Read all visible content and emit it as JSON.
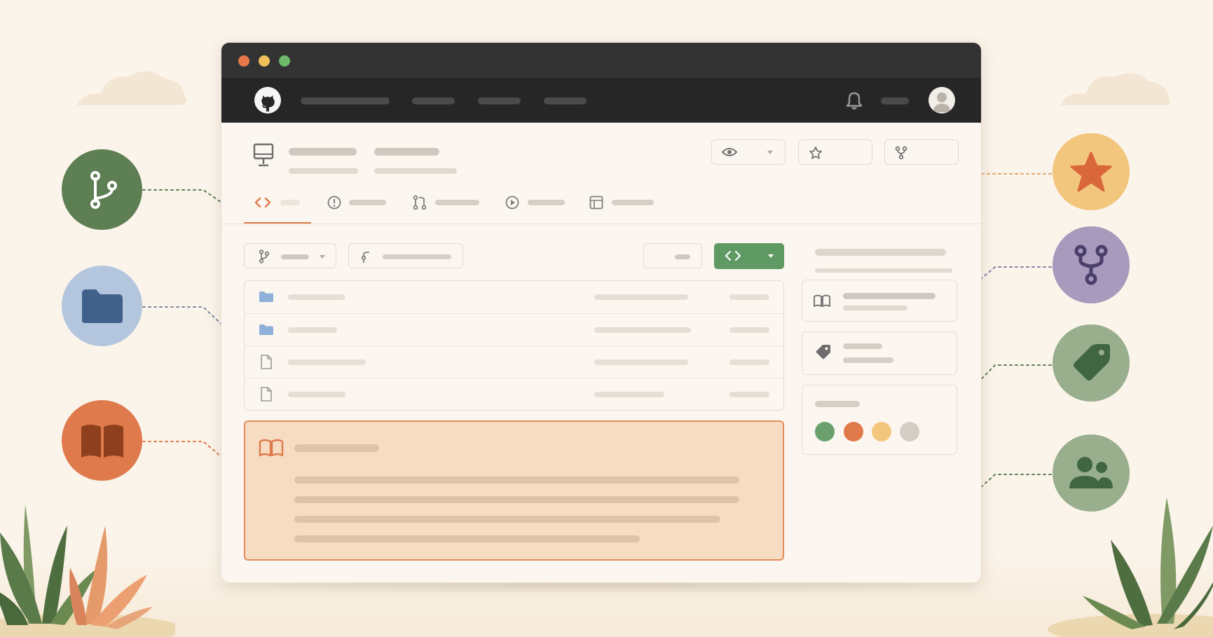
{
  "colors": {
    "background": "#fbf4ea",
    "titlebar": "#333333",
    "navbar": "#262626",
    "accent_orange": "#e07a4a",
    "accent_green": "#5f9a64",
    "readme_fill": "#f7dcc4"
  },
  "window": {
    "traffic_lights": [
      "#e8784a",
      "#f0c05a",
      "#6dbb6a"
    ]
  },
  "navbar": {
    "logo_icon": "github-icon",
    "right_icons": [
      "bell-icon",
      "avatar"
    ]
  },
  "repo_header": {
    "repo_icon": "computer-icon",
    "actions": [
      {
        "icon": "eye-icon",
        "has_dropdown": true
      },
      {
        "icon": "star-icon",
        "has_dropdown": false
      },
      {
        "icon": "fork-icon",
        "has_dropdown": false
      }
    ],
    "tabs": [
      {
        "icon": "code-icon",
        "active": true
      },
      {
        "icon": "issue-icon",
        "active": false
      },
      {
        "icon": "pull-request-icon",
        "active": false
      },
      {
        "icon": "play-icon",
        "active": false
      },
      {
        "icon": "table-icon",
        "active": false
      }
    ]
  },
  "toolbar": {
    "branch_icon": "branch-icon",
    "commit_icon": "commit-icon",
    "code_button_icon": "code-icon"
  },
  "files": [
    {
      "type": "folder-icon"
    },
    {
      "type": "folder-icon"
    },
    {
      "type": "file-icon"
    },
    {
      "type": "file-icon"
    }
  ],
  "readme": {
    "icon": "book-icon"
  },
  "sidebar": {
    "cards": [
      {
        "icon": "book-icon"
      },
      {
        "icon": "tag-icon"
      },
      {
        "icon": "language-dots"
      }
    ],
    "language_colors": [
      "#6aa06c",
      "#e07a4a",
      "#f3c67e",
      "#d3cdc4"
    ]
  },
  "feature_circles": {
    "left": [
      {
        "icon": "branch-icon",
        "color": "#5e7e54"
      },
      {
        "icon": "folder-icon",
        "color": "#b4c6de"
      },
      {
        "icon": "book-icon",
        "color": "#df7a4c"
      }
    ],
    "right": [
      {
        "icon": "star-icon",
        "color": "#f3c67e"
      },
      {
        "icon": "fork-icon",
        "color": "#a79abd"
      },
      {
        "icon": "tag-icon",
        "color": "#98ae8c"
      },
      {
        "icon": "people-icon",
        "color": "#98ae8c"
      }
    ]
  }
}
